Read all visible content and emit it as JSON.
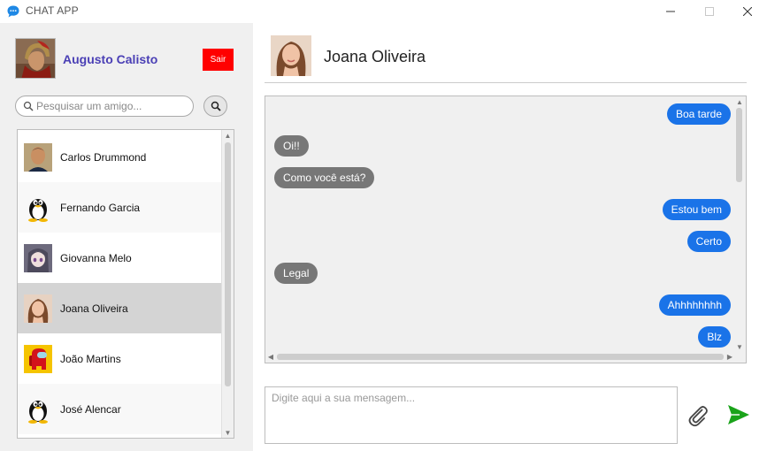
{
  "window": {
    "title": "CHAT APP"
  },
  "user": {
    "name": "Augusto Calisto",
    "logout_label": "Sair"
  },
  "search": {
    "placeholder": "Pesquisar um amigo..."
  },
  "friends": [
    {
      "name": "Carlos Drummond",
      "avatar": "man-photo"
    },
    {
      "name": "Fernando Garcia",
      "avatar": "penguin"
    },
    {
      "name": "Giovanna Melo",
      "avatar": "anime-girl"
    },
    {
      "name": "Joana Oliveira",
      "avatar": "woman-photo",
      "selected": true
    },
    {
      "name": "João Martins",
      "avatar": "among-us"
    },
    {
      "name": "José Alencar",
      "avatar": "penguin"
    }
  ],
  "chat": {
    "contact_name": "Joana Oliveira",
    "messages": [
      {
        "text": "Boa tarde",
        "from": "me"
      },
      {
        "text": "Oi!!",
        "from": "them"
      },
      {
        "text": "Como você está?",
        "from": "them"
      },
      {
        "text": "Estou bem",
        "from": "me"
      },
      {
        "text": "Certo",
        "from": "me"
      },
      {
        "text": "Legal",
        "from": "them"
      },
      {
        "text": "Ahhhhhhhh",
        "from": "me"
      },
      {
        "text": "Blz",
        "from": "me"
      }
    ]
  },
  "composer": {
    "placeholder": "Digite aqui a sua mensagem..."
  },
  "colors": {
    "sent_bubble": "#1a73e8",
    "received_bubble": "#777777",
    "logout": "#ff0000",
    "username": "#4a3fb5",
    "send_icon": "#1aa31a"
  },
  "icons": [
    "chat-app-icon",
    "search-icon",
    "paperclip-icon",
    "send-icon"
  ]
}
